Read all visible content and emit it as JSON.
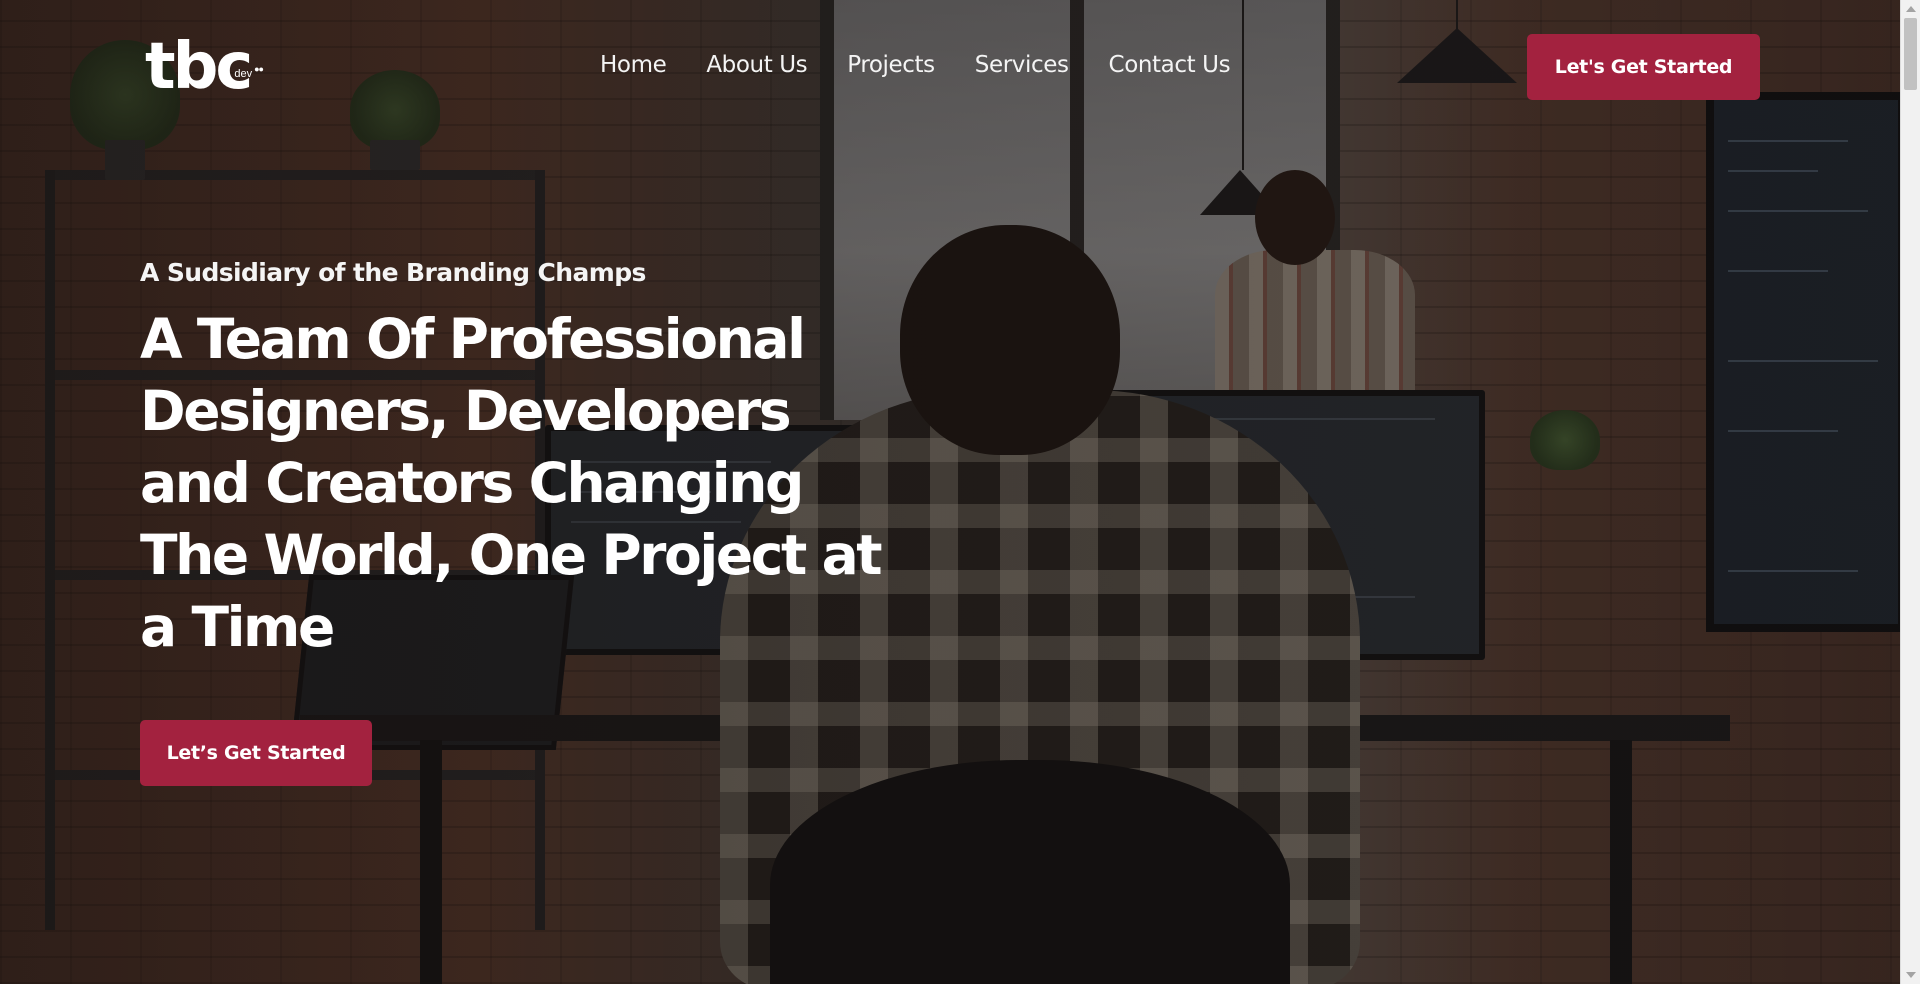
{
  "header": {
    "logo_text": "tbc",
    "logo_sub": "dev",
    "nav": [
      {
        "label": "Home"
      },
      {
        "label": "About Us"
      },
      {
        "label": "Projects"
      },
      {
        "label": "Services"
      },
      {
        "label": "Contact Us"
      }
    ],
    "cta_label": "Let's Get Started"
  },
  "hero": {
    "eyebrow": "A Sudsidiary of the Branding Champs",
    "headline": "A Team Of Professional Designers, Developers and Creators Changing The World, One Project at a Time",
    "cta_label": "Let’s Get Started"
  },
  "colors": {
    "accent": "#a3223f",
    "text": "#ffffff"
  }
}
